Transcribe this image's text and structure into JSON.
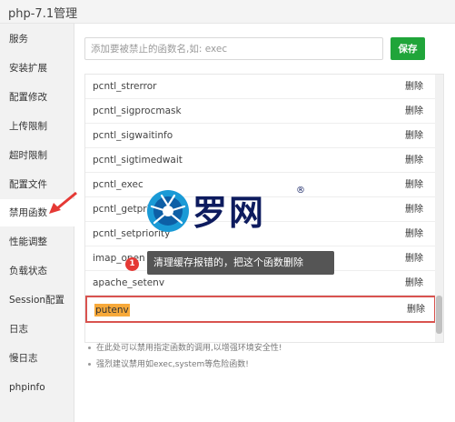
{
  "window": {
    "title": "php-7.1管理"
  },
  "sidebar": {
    "items": [
      {
        "label": "服务",
        "active": false
      },
      {
        "label": "安装扩展",
        "active": false
      },
      {
        "label": "配置修改",
        "active": false
      },
      {
        "label": "上传限制",
        "active": false
      },
      {
        "label": "超时限制",
        "active": false
      },
      {
        "label": "配置文件",
        "active": false
      },
      {
        "label": "禁用函数",
        "active": true
      },
      {
        "label": "性能调整",
        "active": false
      },
      {
        "label": "负载状态",
        "active": false
      },
      {
        "label": "Session配置",
        "active": false
      },
      {
        "label": "日志",
        "active": false
      },
      {
        "label": "慢日志",
        "active": false
      },
      {
        "label": "phpinfo",
        "active": false
      }
    ]
  },
  "form": {
    "placeholder": "添加要被禁止的函数名,如: exec",
    "value": "",
    "save_label": "保存"
  },
  "functions": {
    "delete_label": "删除",
    "rows": [
      {
        "name": "pcntl_strerror"
      },
      {
        "name": "pcntl_sigprocmask"
      },
      {
        "name": "pcntl_sigwaitinfo"
      },
      {
        "name": "pcntl_sigtimedwait"
      },
      {
        "name": "pcntl_exec"
      },
      {
        "name": "pcntl_getpriority"
      },
      {
        "name": "pcntl_setpriority"
      },
      {
        "name": "imap_open"
      },
      {
        "name": "apache_setenv"
      },
      {
        "name": "putenv",
        "highlighted": true
      }
    ]
  },
  "tips": [
    "在此处可以禁用指定函数的调用,以增强环境安全性!",
    "强烈建议禁用如exec,system等危险函数!"
  ],
  "annotation": {
    "badge": "1",
    "text": "清理缓存报错的，把这个函数删除"
  },
  "watermark": {
    "text": "罗网",
    "mark": "®"
  },
  "colors": {
    "accent": "#20a53a",
    "highlight_border": "#d9534f",
    "highlight_fill": "#f7a93a",
    "arrow": "#e53935"
  }
}
